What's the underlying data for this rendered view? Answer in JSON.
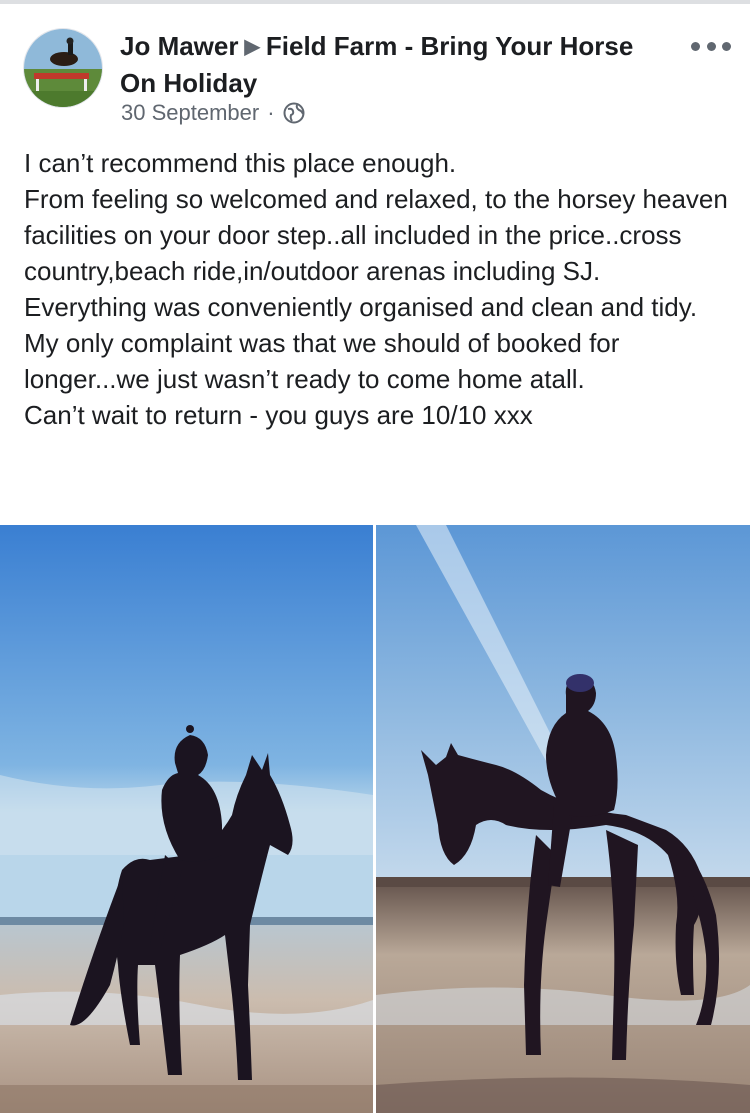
{
  "post": {
    "author": "Jo Mawer",
    "separator_icon": "triangle-right-icon",
    "page_name": "Field Farm - Bring Your Horse On Holiday",
    "date": "30 September",
    "privacy_icon": "globe-icon",
    "more_icon": "more-options-icon"
  },
  "body": {
    "lines": [
      "I can’t recommend this place enough.",
      "From feeling so welcomed and relaxed, to the horsey heaven facilities on your door step..all included in the price..cross country,beach ride,in/outdoor arenas including SJ.",
      "Everything was conveniently organised and clean and tidy.",
      "My only complaint was that we should of booked for longer...we just wasn’t ready to come home atall.",
      "Can’t wait to return - you guys are 10/10 xxx"
    ]
  },
  "photos": [
    {
      "description_icon": "photo-rider-on-beach-left"
    },
    {
      "description_icon": "photo-rider-on-beach-right"
    }
  ],
  "colors": {
    "text": "#1c1e21",
    "secondary": "#606770",
    "sky_top": "#3f86d8",
    "sky_bottom": "#a9cde8",
    "sand": "#c8b6a4",
    "silhouette": "#1b1420"
  }
}
